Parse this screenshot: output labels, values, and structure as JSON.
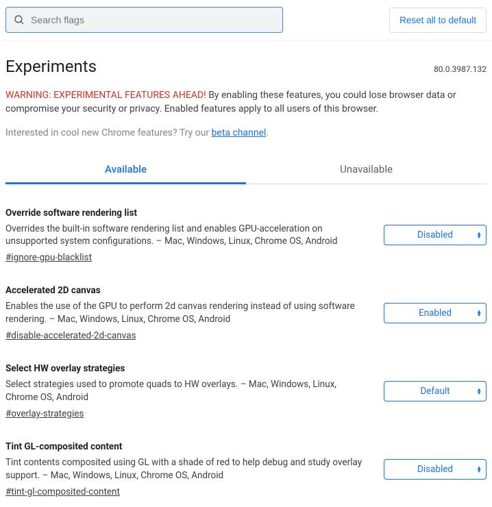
{
  "search": {
    "placeholder": "Search flags"
  },
  "reset_label": "Reset all to default",
  "page_title": "Experiments",
  "version": "80.0.3987.132",
  "warning_prefix": "WARNING: EXPERIMENTAL FEATURES AHEAD!",
  "warning_body": " By enabling these features, you could lose browser data or compromise your security or privacy. Enabled features apply to all users of this browser.",
  "interest_prefix": "Interested in cool new Chrome features? Try our ",
  "interest_link": "beta channel",
  "interest_suffix": ".",
  "tabs": {
    "available": "Available",
    "unavailable": "Unavailable"
  },
  "flags": [
    {
      "title": "Override software rendering list",
      "desc": "Overrides the built-in software rendering list and enables GPU-acceleration on unsupported system configurations. – Mac, Windows, Linux, Chrome OS, Android",
      "hash": "#ignore-gpu-blacklist",
      "value": "Disabled"
    },
    {
      "title": "Accelerated 2D canvas",
      "desc": "Enables the use of the GPU to perform 2d canvas rendering instead of using software rendering. – Mac, Windows, Linux, Chrome OS, Android",
      "hash": "#disable-accelerated-2d-canvas",
      "value": "Enabled"
    },
    {
      "title": "Select HW overlay strategies",
      "desc": "Select strategies used to promote quads to HW overlays. – Mac, Windows, Linux, Chrome OS, Android",
      "hash": "#overlay-strategies",
      "value": "Default"
    },
    {
      "title": "Tint GL-composited content",
      "desc": "Tint contents composited using GL with a shade of red to help debug and study overlay support. – Mac, Windows, Linux, Chrome OS, Android",
      "hash": "#tint-gl-composited-content",
      "value": "Disabled"
    }
  ]
}
